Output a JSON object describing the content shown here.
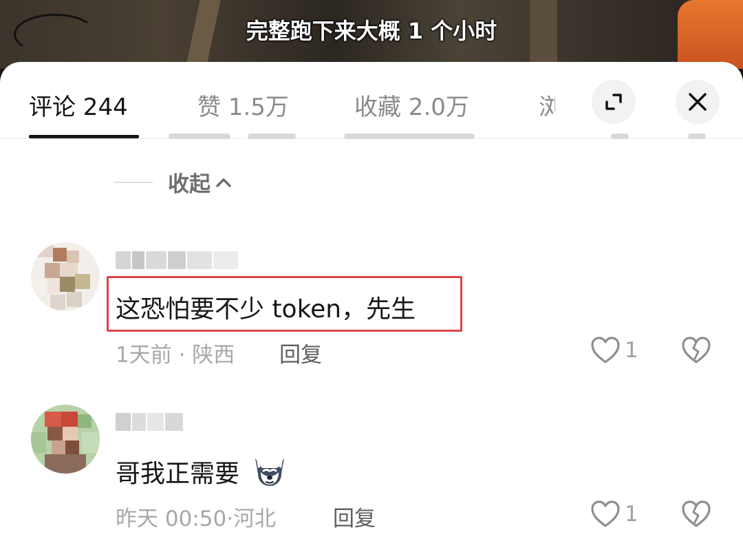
{
  "video": {
    "subtitle": "完整跑下来大概 1 个小时"
  },
  "tabs": [
    {
      "label": "评论 244",
      "active": true
    },
    {
      "label": "赞 1.5万",
      "active": false
    },
    {
      "label": "收藏 2.0万",
      "active": false
    },
    {
      "label": "浏",
      "active": false
    }
  ],
  "controls": {
    "expand_icon": "expand-icon",
    "close_icon": "close-icon"
  },
  "collapse": {
    "label": "收起"
  },
  "comments": [
    {
      "text": "这恐怕要不少 token，先生",
      "time": "1天前",
      "location": "陕西",
      "reply_label": "回复",
      "likes": "1",
      "highlighted": true
    },
    {
      "text": "哥我正需要",
      "emoji": "husky-emoji",
      "time": "昨天 00:50",
      "location": "河北",
      "reply_label": "回复",
      "likes": "1",
      "highlighted": false
    }
  ],
  "colors": {
    "highlight_border": "#e0424a",
    "text_primary": "#161616",
    "text_secondary": "#a8a8a8"
  }
}
